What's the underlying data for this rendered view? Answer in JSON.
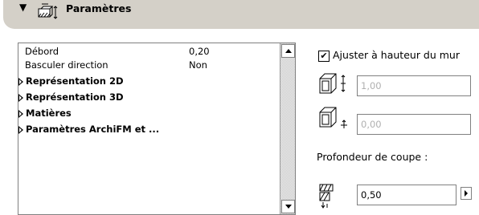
{
  "header": {
    "title": "Paramètres",
    "icon": "wall-tool-icon"
  },
  "list": {
    "rows": [
      {
        "label": "Débord",
        "value": "0,20"
      },
      {
        "label": "Basculer direction",
        "value": "Non"
      }
    ],
    "groups": [
      {
        "label": "Représentation 2D"
      },
      {
        "label": "Représentation 3D"
      },
      {
        "label": "Matières"
      },
      {
        "label": "Paramètres ArchiFM et ..."
      }
    ]
  },
  "side": {
    "adjust_checkbox_label": "Ajuster à hauteur du mur",
    "adjust_checked": true,
    "check_mark": "✔",
    "height_field": "1,00",
    "offset_field": "0,00",
    "cut_depth_label": "Profondeur de coupe :",
    "cut_depth_value": "0,50"
  }
}
